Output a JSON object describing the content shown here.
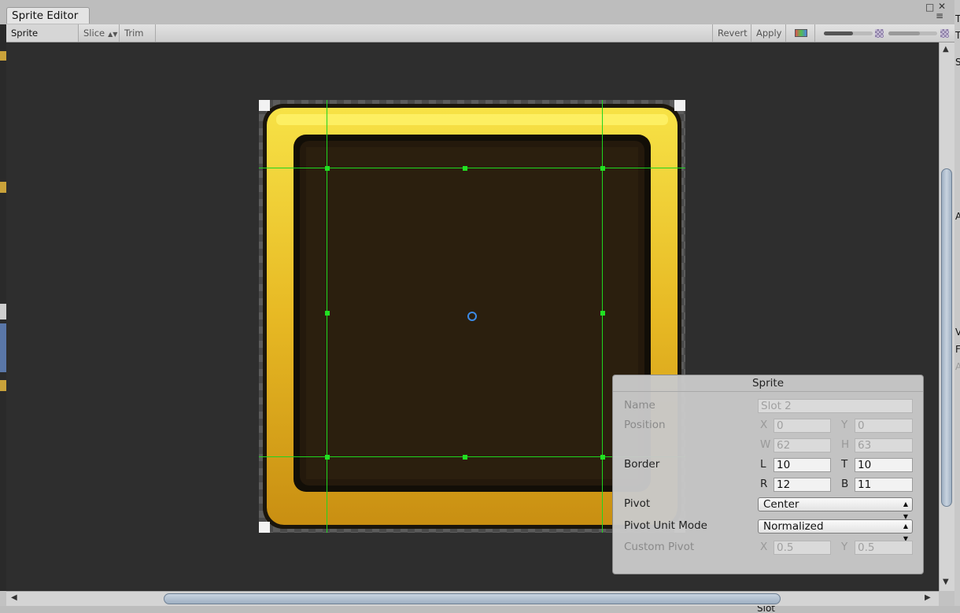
{
  "window": {
    "tab_title": "Sprite Editor",
    "maximize_icon": "maximize-icon",
    "close_icon": "close-icon",
    "menu_icon": "menu-icon"
  },
  "toolbar": {
    "mode_label": "Sprite Editor",
    "slice_label": "Slice",
    "trim_label": "Trim",
    "revert_label": "Revert",
    "apply_label": "Apply",
    "color_icon": "rgb-channel-icon",
    "zoom_level": 0.6,
    "mip_level": 0.65
  },
  "sprite_panel": {
    "title": "Sprite",
    "name_label": "Name",
    "name_value": "Slot 2",
    "position_label": "Position",
    "x_label": "X",
    "x_value": "0",
    "y_label": "Y",
    "y_value": "0",
    "w_label": "W",
    "w_value": "62",
    "h_label": "H",
    "h_value": "63",
    "border_label": "Border",
    "l_label": "L",
    "l_value": "10",
    "t_label": "T",
    "t_value": "10",
    "r_label": "R",
    "r_value": "12",
    "b_label": "B",
    "b_value": "11",
    "pivot_label": "Pivot",
    "pivot_value": "Center",
    "pivot_unit_label": "Pivot Unit Mode",
    "pivot_unit_value": "Normalized",
    "custom_pivot_label": "Custom Pivot",
    "cx_label": "X",
    "cx_value": "0.5",
    "cy_label": "Y",
    "cy_value": "0.5"
  },
  "background": {
    "right_letters": [
      "T",
      "T",
      "S",
      "A",
      "V",
      "F",
      "A"
    ],
    "bottom_label": "Slot"
  },
  "colors": {
    "guide": "#1fd61f",
    "pivot": "#3c8be6",
    "gold": "#e8b81e",
    "canvas": "#2e2e2e"
  }
}
